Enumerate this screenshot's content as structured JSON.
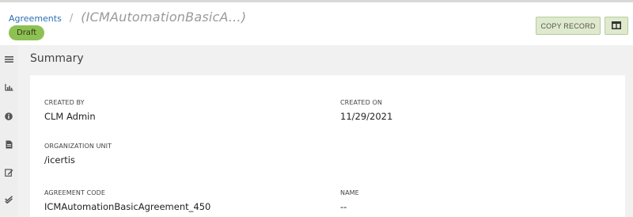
{
  "breadcrumb": {
    "link": "Agreements",
    "separator": "/",
    "title": "(ICMAutomationBasicA…)"
  },
  "status": "Draft",
  "toolbar": {
    "copy_label": "COPY RECORD",
    "layout_icon": "columns-icon"
  },
  "sidebar": {
    "icons": [
      "menu-icon",
      "chart-icon",
      "info-icon",
      "document-icon",
      "edit-icon",
      "check-icon"
    ]
  },
  "summary": {
    "title": "Summary",
    "fields": {
      "created_by": {
        "label": "CREATED BY",
        "value": "CLM Admin"
      },
      "created_on": {
        "label": "CREATED ON",
        "value": "11/29/2021"
      },
      "organization_unit": {
        "label": "ORGANIZATION UNIT",
        "value": "/icertis"
      },
      "agreement_code": {
        "label": "AGREEMENT CODE",
        "value": "ICMAutomationBasicAgreement_450"
      },
      "name": {
        "label": "NAME",
        "value": "--"
      }
    }
  },
  "colors": {
    "link": "#2d6fb3",
    "badge": "#8ec153",
    "button_bg": "#dfe9cd"
  }
}
